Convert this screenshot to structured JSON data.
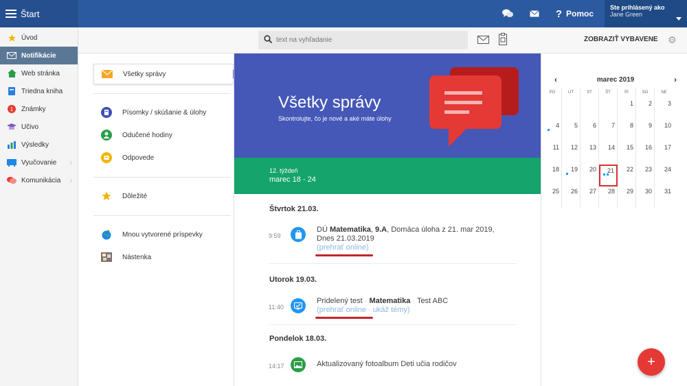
{
  "topbar": {
    "start_label": "Štart",
    "help_label": "Pomoc",
    "user_line1": "Ste prihlásený ako",
    "user_line2": "Jane Green"
  },
  "sidebar": {
    "items": [
      {
        "label": "Úvod",
        "icon": "star-icon"
      },
      {
        "label": "Notifikácie",
        "icon": "envelope-icon"
      },
      {
        "label": "Web stránka",
        "icon": "home-icon"
      },
      {
        "label": "Triedna kniha",
        "icon": "book-icon"
      },
      {
        "label": "Známky",
        "icon": "grade-icon"
      },
      {
        "label": "Učivo",
        "icon": "graduation-icon"
      },
      {
        "label": "Výsledky",
        "icon": "bar-chart-icon"
      },
      {
        "label": "Vyučovanie",
        "icon": "board-icon"
      },
      {
        "label": "Komunikácia",
        "icon": "chat-icon"
      }
    ]
  },
  "subbar": {
    "search_placeholder": "text na vyhľadanie",
    "show_equipped_label": "ZOBRAZIŤ VYBAVENE"
  },
  "folders": {
    "all": "Všetky správy",
    "tests": "Písomky / skúšanie & úlohy",
    "lessons": "Odučené hodiny",
    "answers": "Odpovede",
    "important": "Dôležité",
    "mine": "Mnou vytvorené príspevky",
    "board": "Nástenka"
  },
  "hero": {
    "title": "Všetky správy",
    "subtitle": "Skontrolujte, čo je nové a aké máte úlohy"
  },
  "week": {
    "week_label": "12. týždeň",
    "date_range": "marec 18 - 24"
  },
  "feed": {
    "day1": "Štvrtok 21.03.",
    "e1_time": "9:59",
    "e1_prefix": "DÚ ",
    "e1_subject": "Matematika",
    "e1_sep": ", ",
    "e1_class": "9.A",
    "e1_rest": ", Domáca úloha z 21. mar 2019,",
    "e1_line2": "Dnes 21.03.2019",
    "e1_link": "(prehrať online)",
    "day2": "Utorok 19.03.",
    "e2_time": "11:40",
    "e2_prefix": "Pridelený test",
    "e2_dot": " · ",
    "e2_subject": "Matematika",
    "e2_dot2": " · ",
    "e2_rest": "Test ABC",
    "e2_link1": "(prehrať online",
    "e2_link_sep": " · ",
    "e2_link2": "ukáž témy)",
    "day3": "Pondelok 18.03.",
    "e3_time": "14:17",
    "e3_text": "Aktualizovaný fotoalbum Deti učia rodičov"
  },
  "calendar": {
    "month": "marec 2019",
    "weekdays": [
      "PO",
      "UT",
      "ST",
      "ŠT",
      "PI",
      "SO",
      "NE"
    ],
    "weeks": [
      [
        "",
        "",
        "",
        "",
        "1",
        "2",
        "3"
      ],
      [
        "4",
        "5",
        "6",
        "7",
        "8",
        "9",
        "10"
      ],
      [
        "11",
        "12",
        "13",
        "14",
        "15",
        "16",
        "17"
      ],
      [
        "18",
        "19",
        "20",
        "21",
        "22",
        "23",
        "24"
      ],
      [
        "25",
        "26",
        "27",
        "28",
        "29",
        "30",
        "31"
      ]
    ]
  },
  "colors": {
    "topbar": "#2c5aa0",
    "hero": "#4557b7",
    "week": "#14a46c",
    "fab": "#e53935",
    "highlight": "#d32f2f"
  }
}
